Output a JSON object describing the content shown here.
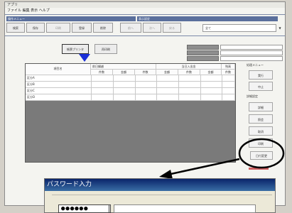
{
  "window": {
    "title": "アプリ",
    "menu": "ファイル 編集 表示 ヘルプ"
  },
  "toolbar": {
    "group1_label": "操作メニュー",
    "group2_label": "表示設定",
    "buttons": [
      "検索",
      "保存",
      "印刷",
      "登録",
      "削除",
      "前へ",
      "次へ",
      "戻る"
    ],
    "combo_value": "全て"
  },
  "top_buttons": {
    "primary": "帳票プリンタ",
    "secondary": "再印刷"
  },
  "grid": {
    "col_groups": [
      "項目名",
      "前日繰越",
      "当日入出金",
      "残高"
    ],
    "subcols": [
      "件数",
      "金額",
      "件数",
      "金額",
      "件数",
      "金額",
      "件数"
    ],
    "rows": [
      "区分A",
      "区分B",
      "区分C",
      "区分D"
    ]
  },
  "side": {
    "group1_label": "処理メニュー",
    "group2_label": "詳細設定",
    "buttons": [
      "実行",
      "中止",
      "詳細",
      "照会",
      "取消",
      "印刷",
      "日付変更"
    ]
  },
  "dialog": {
    "title": "パスワード入力",
    "password": "●●●●●●"
  }
}
